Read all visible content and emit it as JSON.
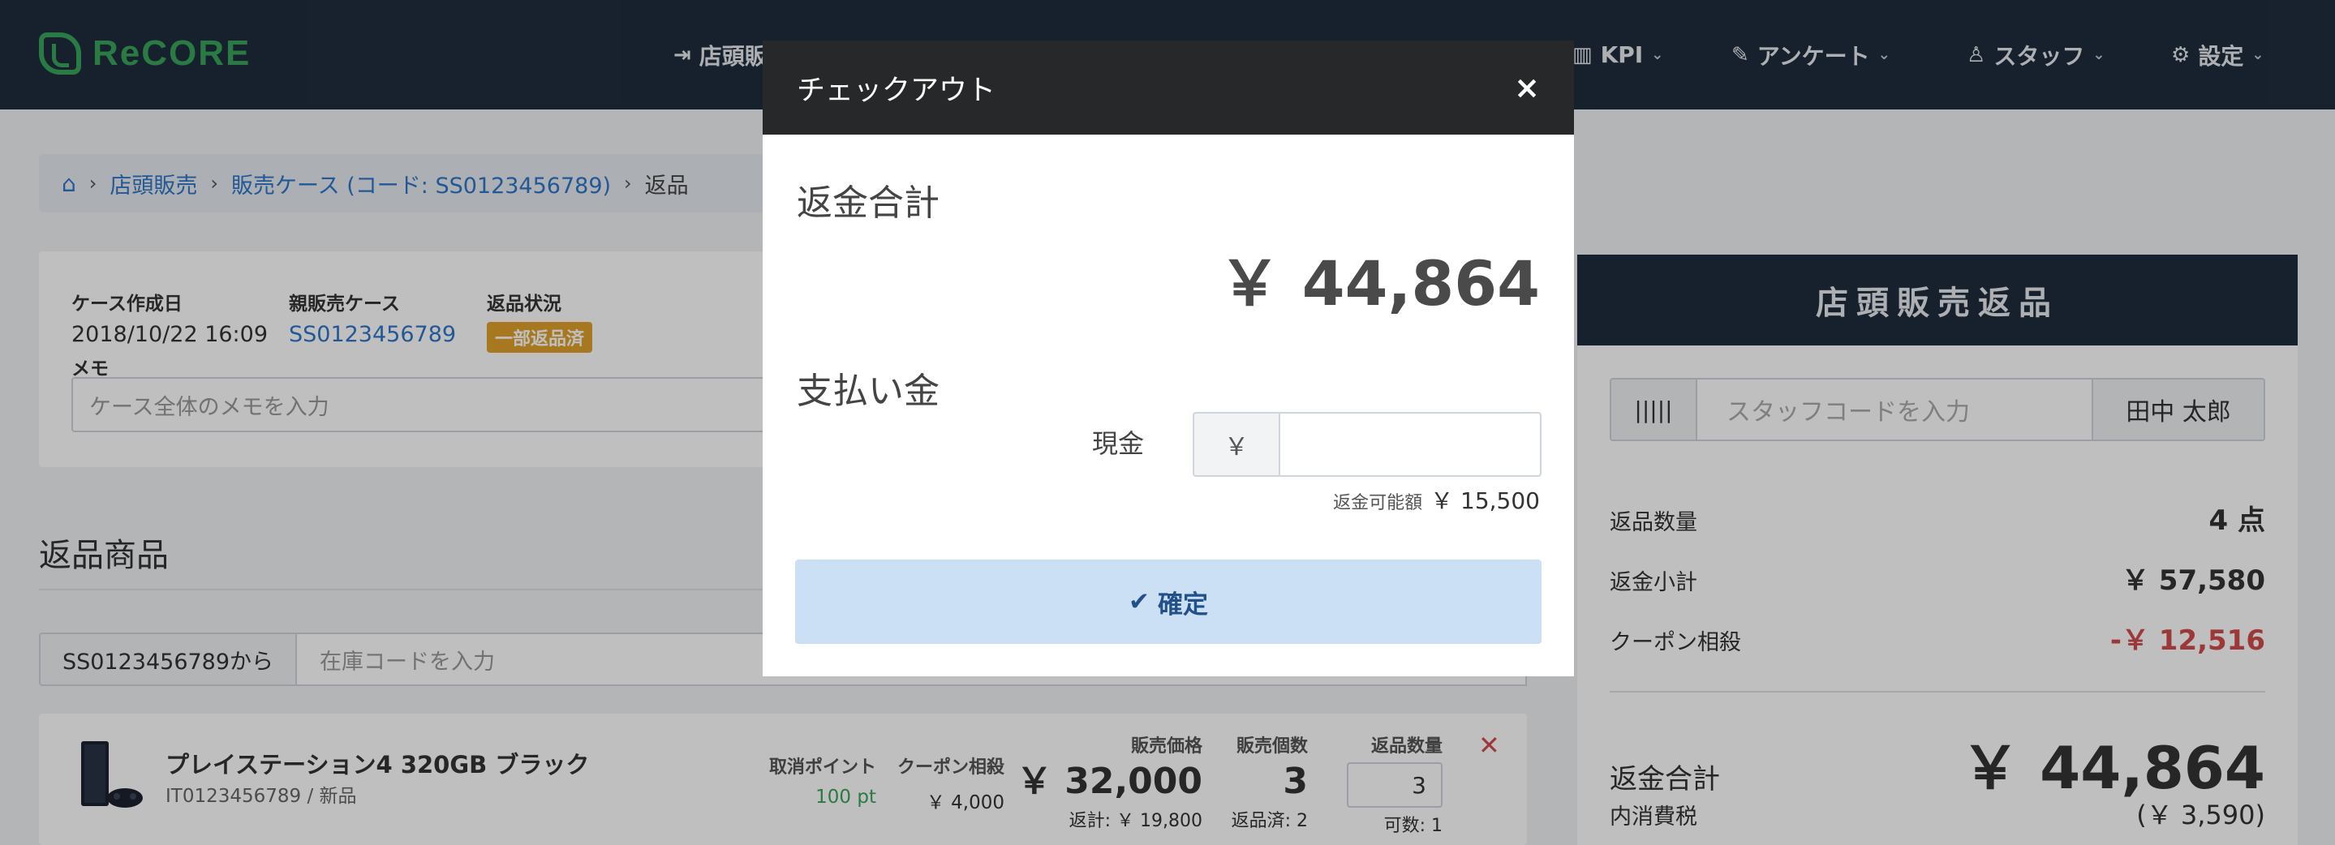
{
  "header": {
    "logo": "ReCORE",
    "nav": [
      {
        "label": "店頭販売",
        "icon": "sign-in-icon"
      },
      {
        "label": "KPI",
        "icon": "bar-chart-icon"
      },
      {
        "label": "アンケート",
        "icon": "edit-icon"
      },
      {
        "label": "スタッフ",
        "icon": "user-icon"
      },
      {
        "label": "設定",
        "icon": "gear-icon"
      }
    ]
  },
  "breadcrumb": {
    "items": [
      "店頭販売",
      "販売ケース (コード: SS0123456789)",
      "返品"
    ]
  },
  "case": {
    "created_label": "ケース作成日",
    "created_value": "2018/10/22 16:09",
    "parent_label": "親販売ケース",
    "parent_value": "SS0123456789",
    "status_label": "返品状況",
    "status_value": "一部返品済",
    "memo_label": "メモ",
    "memo_placeholder": "ケース全体のメモを入力"
  },
  "returns": {
    "title": "返品商品",
    "scan_prefix": "SS0123456789から",
    "scan_placeholder": "在庫コードを入力",
    "item": {
      "name": "プレイステーション4 320GB ブラック",
      "sub": "IT0123456789 / 新品",
      "cancel_points_label": "取消ポイント",
      "cancel_points_value": "100 pt",
      "coupon_label": "クーポン相殺",
      "coupon_value": "￥ 4,000",
      "price_label": "販売価格",
      "price_value": "￥ 32,000",
      "price_sub": "返計: ￥ 19,800",
      "sold_qty_label": "販売個数",
      "sold_qty_value": "3",
      "sold_qty_sub": "返品済: 2",
      "return_qty_label": "返品数量",
      "return_qty_value": "3",
      "return_qty_sub": "可数: 1"
    }
  },
  "right_panel": {
    "title": "店頭販売返品",
    "staff_placeholder": "スタッフコードを入力",
    "staff_name": "田中 太郎",
    "return_qty_label": "返品数量",
    "return_qty_value": "4 点",
    "subtotal_label": "返金小計",
    "subtotal_value": "￥ 57,580",
    "coupon_label": "クーポン相殺",
    "coupon_value": "-￥ 12,516",
    "total_label": "返金合計",
    "total_value": "￥ 44,864",
    "tax_label": "内消費税",
    "tax_value": "(￥ 3,590)"
  },
  "modal": {
    "title": "チェックアウト",
    "close": "×",
    "refund_total_label": "返金合計",
    "refund_total_value": "￥ 44,864",
    "payment_label": "支払い金",
    "cash_label": "現金",
    "currency_symbol": "￥",
    "cash_value": "",
    "refundable_label": "返金可能額",
    "refundable_value": "￥ 15,500",
    "confirm_label": "確定"
  }
}
